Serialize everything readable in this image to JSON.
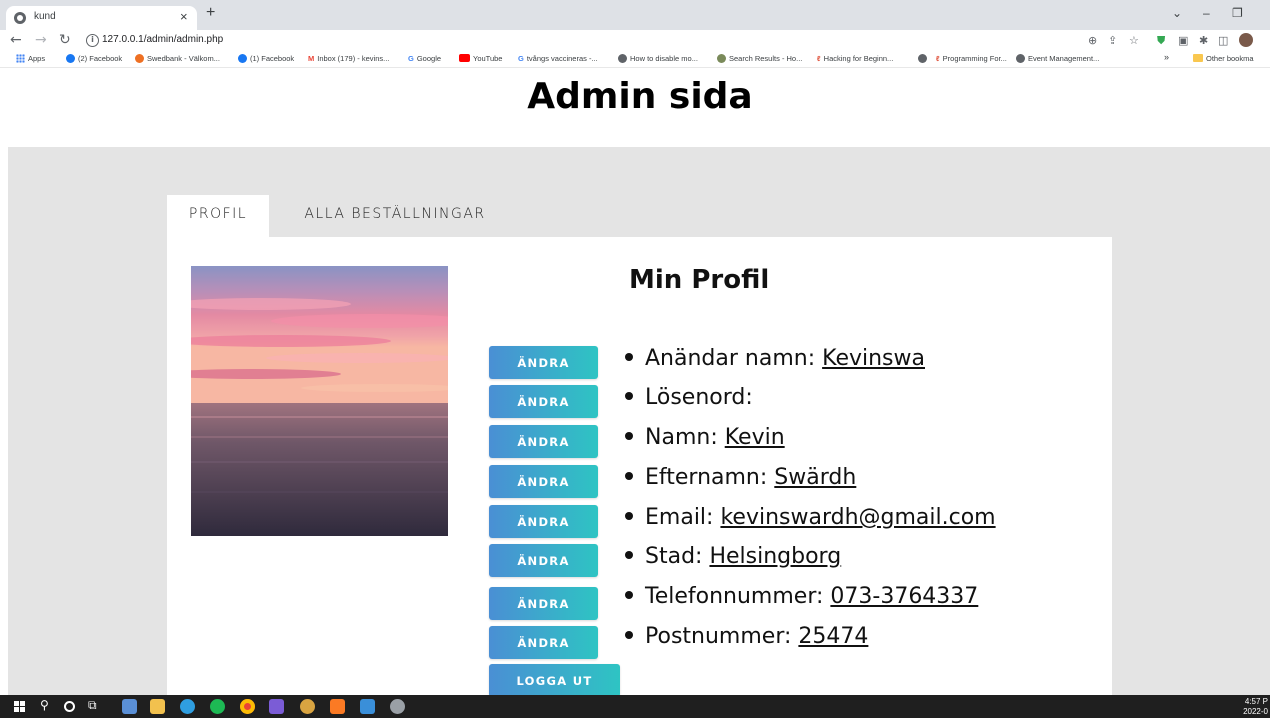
{
  "browser": {
    "tab_title": "kund",
    "tab_close": "×",
    "new_tab": "+",
    "url": "127.0.0.1/admin/admin.php",
    "bookmarks": [
      {
        "label": "Apps",
        "color": "#4285f4"
      },
      {
        "label": "(2) Facebook",
        "color": "#1877f2"
      },
      {
        "label": "Swedbank - Välkom...",
        "color": "#ee7023"
      },
      {
        "label": "(1) Facebook",
        "color": "#1877f2"
      },
      {
        "label": "Inbox (179) - kevins...",
        "color": "#ea4335"
      },
      {
        "label": "Google",
        "color": "#4285f4"
      },
      {
        "label": "YouTube",
        "color": "#ff0000"
      },
      {
        "label": "tvångs vaccineras -...",
        "color": "#4285f4"
      },
      {
        "label": "How to disable mo...",
        "color": "#5f6368"
      },
      {
        "label": "Search Results - Ho...",
        "color": "#7a8a5a"
      },
      {
        "label": "Hacking for Beginn...",
        "color": "#e0533d"
      },
      {
        "label": "",
        "color": "#5f6368"
      },
      {
        "label": "Programming For...",
        "color": "#e0533d"
      },
      {
        "label": "Event Management...",
        "color": "#5f6368"
      }
    ],
    "other_bookmarks": "Other bookma",
    "more_bookmarks": "»"
  },
  "page": {
    "title": "Admin sida",
    "tabs": [
      {
        "label": "PROFIL",
        "active": true
      },
      {
        "label": "ALLA BESTÄLLNINGAR",
        "active": false
      }
    ],
    "profile_title": "Min Profil",
    "edit_label": "ÄNDRA",
    "logout_label": "LOGGA UT",
    "fields": [
      {
        "label": "Anändar namn: ",
        "value": "Kevinswa"
      },
      {
        "label": "Lösenord: ",
        "value": ""
      },
      {
        "label": "Namn: ",
        "value": "Kevin"
      },
      {
        "label": "Efternamn: ",
        "value": "Swärdh "
      },
      {
        "label": "Email: ",
        "value": "kevinswardh@gmail.com"
      },
      {
        "label": "Stad: ",
        "value": "Helsingborg"
      },
      {
        "label": "Telefonnummer: ",
        "value": "073-3764337"
      },
      {
        "label": "Postnummer: ",
        "value": "25474"
      }
    ],
    "accent_start": "#4a8fd4",
    "accent_end": "#2ec4c3",
    "band_color": "#e4e4e4"
  },
  "taskbar": {
    "time": "4:57 P",
    "date": "2022-0"
  }
}
